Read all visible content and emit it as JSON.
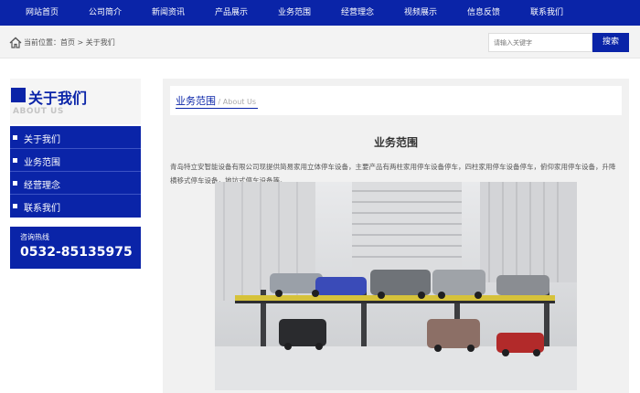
{
  "nav": {
    "items": [
      "网站首页",
      "公司简介",
      "新闻资讯",
      "产品展示",
      "业务范围",
      "经营理念",
      "视频展示",
      "信息反馈",
      "联系我们"
    ]
  },
  "breadcrumb": {
    "text": "当前位置：首页 > 关于我们"
  },
  "search": {
    "placeholder": "请输入关键字",
    "button_label": "搜索"
  },
  "sidebar": {
    "title": "关于我们",
    "subtitle": "ABOUT US",
    "items": [
      {
        "label": "关于我们"
      },
      {
        "label": "业务范围"
      },
      {
        "label": "经营理念"
      },
      {
        "label": "联系我们"
      }
    ],
    "hotline_label": "咨询热线",
    "hotline_number": "0532-85135975"
  },
  "main": {
    "title": "业务范围",
    "title_en": " / About Us",
    "article_title": "业务范围",
    "article_body": "青岛特立安智能设备有限公司现提供简易家用立体停车设备，主要产品有两柱家用停车设备停车，四柱家用停车设备停车，俯仰家用停车设备，升降横移式停车设备，地坑式停车设备等。"
  },
  "colors": {
    "brand": "#0a24a8",
    "panel": "#f1f1f1"
  }
}
